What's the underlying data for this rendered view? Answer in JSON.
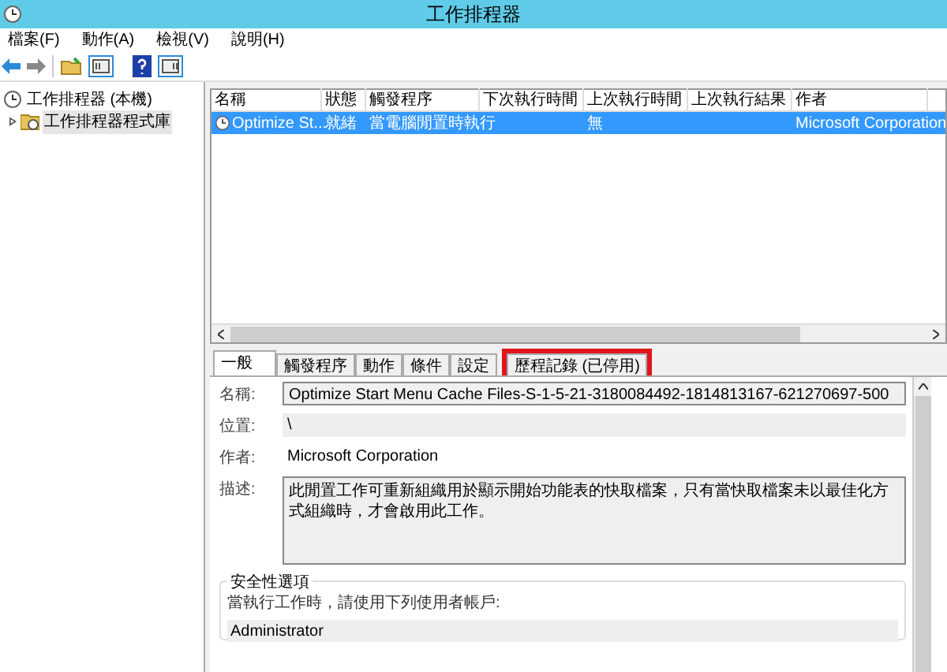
{
  "window": {
    "title": "工作排程器"
  },
  "menu": [
    "檔案(F)",
    "動作(A)",
    "檢視(V)",
    "說明(H)"
  ],
  "tree": [
    {
      "label": "工作排程器 (本機)",
      "selected": false,
      "children": [
        {
          "label": "工作排程器程式庫",
          "expanded": false,
          "selected": true
        }
      ]
    }
  ],
  "table": {
    "columns": [
      "名稱",
      "狀態",
      "觸發程序",
      "下次執行時間",
      "上次執行時間",
      "上次執行結果",
      "作者"
    ],
    "rows": [
      {
        "selected": true,
        "cells": [
          "Optimize St...",
          "就緒",
          "當電腦閒置時執行",
          "",
          "無",
          "",
          "Microsoft Corporation"
        ]
      }
    ]
  },
  "tabs": [
    {
      "label": "一般",
      "selected": true,
      "highlighted": false
    },
    {
      "label": "觸發程序",
      "selected": false,
      "highlighted": false
    },
    {
      "label": "動作",
      "selected": false,
      "highlighted": false
    },
    {
      "label": "條件",
      "selected": false,
      "highlighted": false
    },
    {
      "label": "設定",
      "selected": false,
      "highlighted": false
    },
    {
      "label": "歷程記錄 (已停用)",
      "selected": false,
      "highlighted": true
    }
  ],
  "general": {
    "fields": [
      {
        "label": "名稱:",
        "value": "Optimize Start Menu Cache Files-S-1-5-21-3180084492-1814813167-621270697-500",
        "kind": "field"
      },
      {
        "label": "位置:",
        "value": "\\",
        "kind": "readonly"
      },
      {
        "label": "作者:",
        "value": "Microsoft Corporation",
        "kind": "plain"
      },
      {
        "label": "描述:",
        "value": "此閒置工作可重新組織用於顯示開始功能表的快取檔案，只有當快取檔案未以最佳化方式組織時，才會啟用此工作。",
        "kind": "area"
      }
    ],
    "security": {
      "title": "安全性選項",
      "prompt": "當執行工作時，請使用下列使用者帳戶:",
      "account": "Administrator"
    }
  }
}
